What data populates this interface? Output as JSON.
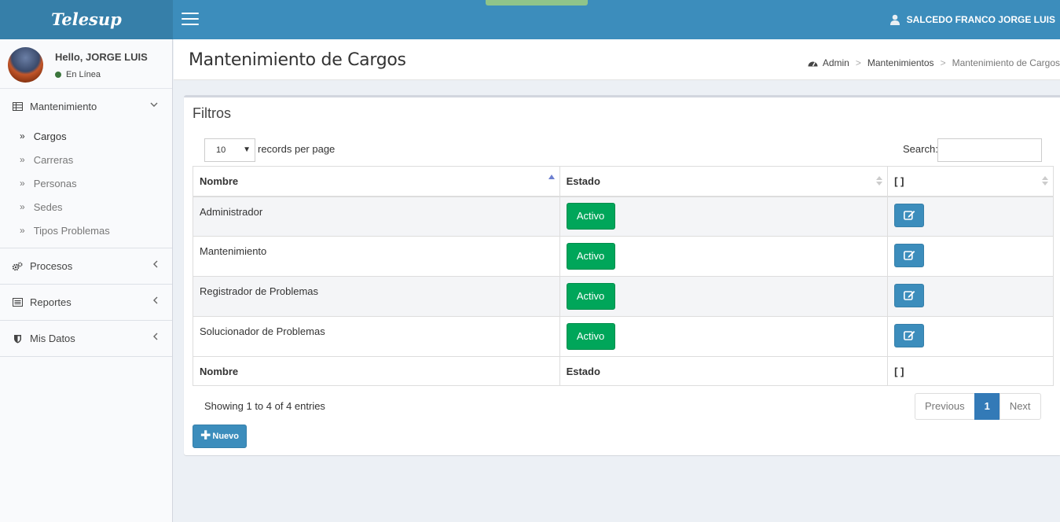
{
  "app": {
    "logo": "Telesup",
    "user_name": "SALCEDO FRANCO JORGE LUIS"
  },
  "sidebar": {
    "hello": "Hello, JORGE LUIS",
    "status": "En Línea",
    "groups": [
      {
        "label": "Mantenimiento",
        "items": [
          {
            "label": "Cargos"
          },
          {
            "label": "Carreras"
          },
          {
            "label": "Personas"
          },
          {
            "label": "Sedes"
          },
          {
            "label": "Tipos Problemas"
          }
        ]
      },
      {
        "label": "Procesos"
      },
      {
        "label": "Reportes"
      },
      {
        "label": "Mis Datos"
      }
    ]
  },
  "content": {
    "title": "Mantenimiento de Cargos",
    "breadcrumb": [
      "Admin",
      "Mantenimientos",
      "Mantenimiento de Cargos"
    ]
  },
  "box": {
    "title": "Filtros",
    "length_value": "10",
    "length_label": "records per page",
    "search_label": "Search:",
    "columns": [
      "Nombre",
      "Estado",
      "[ ]"
    ],
    "rows": [
      {
        "nombre": "Administrador",
        "estado": "Activo"
      },
      {
        "nombre": "Mantenimiento",
        "estado": "Activo"
      },
      {
        "nombre": "Registrador de Problemas",
        "estado": "Activo"
      },
      {
        "nombre": "Solucionador de Problemas",
        "estado": "Activo"
      }
    ],
    "info": "Showing 1 to 4 of 4 entries",
    "pager": {
      "previous": "Previous",
      "current": "1",
      "next": "Next"
    },
    "new_button": "Nuevo"
  },
  "colors": {
    "header": "#3c8dbc",
    "logo_bg": "#367fa9",
    "success": "#00a65a",
    "primary": "#3c8dbc"
  }
}
